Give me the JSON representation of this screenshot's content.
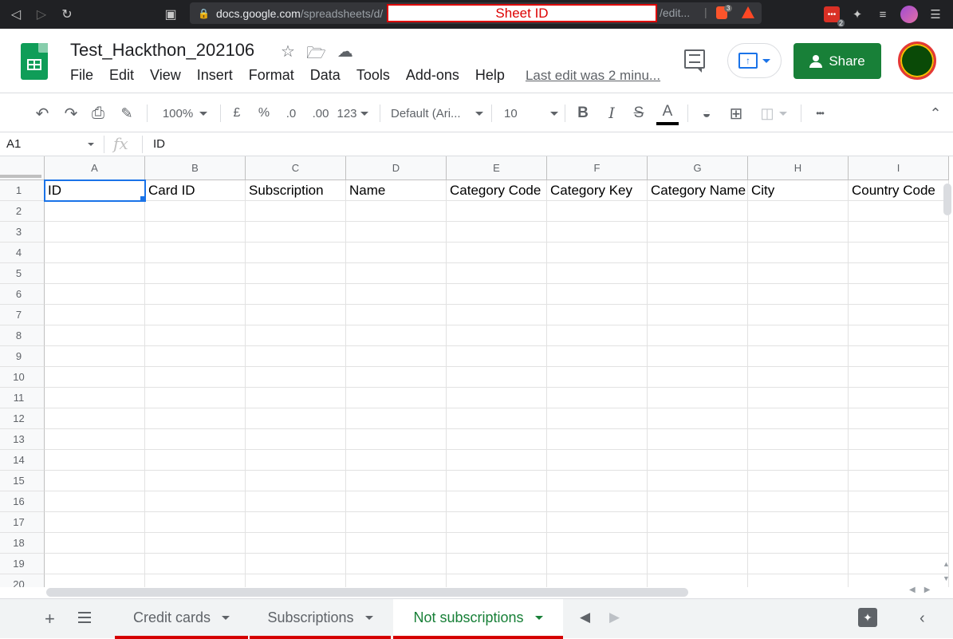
{
  "browser": {
    "url_host": "docs.google.com",
    "url_path": "/spreadsheets/d/",
    "redaction_label": "Sheet ID",
    "url_tail": "/edit...",
    "brave_badge": "3",
    "ext_badge": "2"
  },
  "doc": {
    "title": "Test_Hackthon_202106",
    "last_edit": "Last edit was 2 minu..."
  },
  "menu": [
    "File",
    "Edit",
    "View",
    "Insert",
    "Format",
    "Data",
    "Tools",
    "Add-ons",
    "Help"
  ],
  "share_label": "Share",
  "toolbar": {
    "zoom": "100%",
    "currency": "£",
    "percent": "%",
    "dec_less": ".0",
    "dec_more": ".00",
    "format_more": "123",
    "font": "Default (Ari...",
    "font_size": "10",
    "bold": "B",
    "italic": "I",
    "strike": "S",
    "text_color": "A",
    "more": "•••"
  },
  "formula": {
    "cell_ref": "A1",
    "fx": "fx",
    "value": "ID"
  },
  "grid": {
    "columns": [
      "A",
      "B",
      "C",
      "D",
      "E",
      "F",
      "G",
      "H",
      "I"
    ],
    "rows": [
      "1",
      "2",
      "3",
      "4",
      "5",
      "6",
      "7",
      "8",
      "9",
      "10",
      "11",
      "12",
      "13",
      "14",
      "15",
      "16",
      "17",
      "18",
      "19",
      "20"
    ],
    "header_row": [
      "ID",
      "Card ID",
      "Subscription",
      "Name",
      "Category Code",
      "Category Key",
      "Category Name",
      "City",
      "Country Code"
    ]
  },
  "sheets": {
    "tabs": [
      "Credit cards",
      "Subscriptions",
      "Not subscriptions"
    ],
    "active": "Not subscriptions"
  },
  "colors": {
    "accent_green": "#188038",
    "tab_underline": "#d50000",
    "selection_blue": "#1a73e8"
  }
}
